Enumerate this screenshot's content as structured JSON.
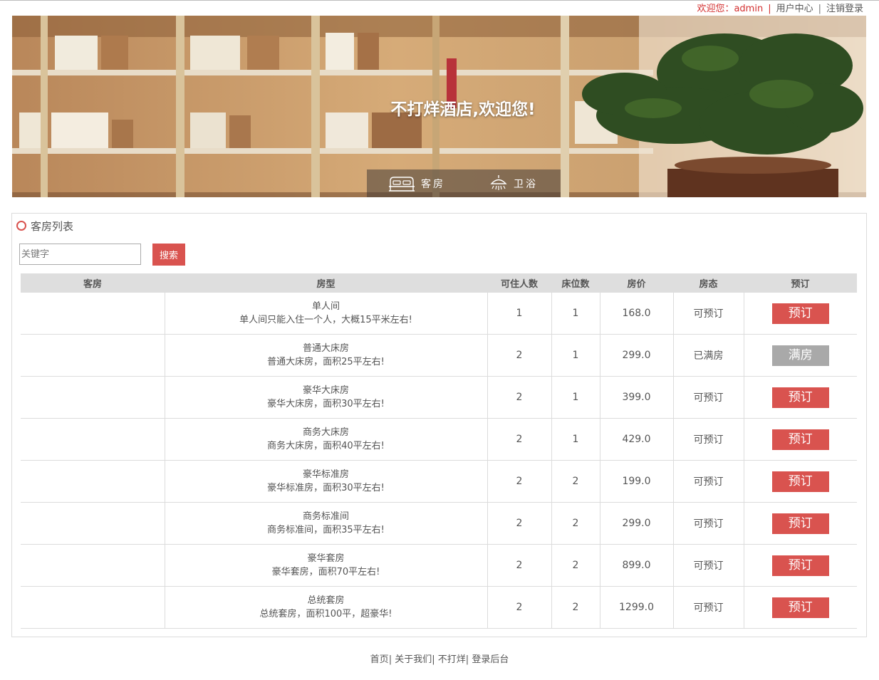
{
  "topbar": {
    "welcome": "欢迎您：admin",
    "sep": "|",
    "user_center": "用户中心",
    "logout": "注销登录"
  },
  "banner": {
    "title": "不打烊酒店,欢迎您!",
    "nav": [
      {
        "label": "客房",
        "icon": "bed-icon"
      },
      {
        "label": "卫浴",
        "icon": "shower-icon"
      }
    ]
  },
  "panel": {
    "title": "客房列表",
    "search_placeholder": "关键字",
    "search_button": "搜索"
  },
  "table": {
    "headers": [
      "客房",
      "房型",
      "可住人数",
      "床位数",
      "房价",
      "房态",
      "预订"
    ],
    "rows": [
      {
        "name": "单人间",
        "desc": "单人间只能入住一个人，大概15平米左右!",
        "people": "1",
        "beds": "1",
        "price": "168.0",
        "status": "可预订",
        "action": "预订",
        "available": true
      },
      {
        "name": "普通大床房",
        "desc": "普通大床房，面积25平左右!",
        "people": "2",
        "beds": "1",
        "price": "299.0",
        "status": "已满房",
        "action": "满房",
        "available": false
      },
      {
        "name": "豪华大床房",
        "desc": "豪华大床房，面积30平左右!",
        "people": "2",
        "beds": "1",
        "price": "399.0",
        "status": "可预订",
        "action": "预订",
        "available": true
      },
      {
        "name": "商务大床房",
        "desc": "商务大床房，面积40平左右!",
        "people": "2",
        "beds": "1",
        "price": "429.0",
        "status": "可预订",
        "action": "预订",
        "available": true
      },
      {
        "name": "豪华标准房",
        "desc": "豪华标准房，面积30平左右!",
        "people": "2",
        "beds": "2",
        "price": "199.0",
        "status": "可预订",
        "action": "预订",
        "available": true
      },
      {
        "name": "商务标准间",
        "desc": "商务标准间，面积35平左右!",
        "people": "2",
        "beds": "2",
        "price": "299.0",
        "status": "可预订",
        "action": "预订",
        "available": true
      },
      {
        "name": "豪华套房",
        "desc": "豪华套房，面积70平左右!",
        "people": "2",
        "beds": "2",
        "price": "899.0",
        "status": "可预订",
        "action": "预订",
        "available": true
      },
      {
        "name": "总统套房",
        "desc": "总统套房，面积100平，超豪华!",
        "people": "2",
        "beds": "2",
        "price": "1299.0",
        "status": "可预订",
        "action": "预订",
        "available": true
      }
    ]
  },
  "footer": {
    "links": [
      "首页",
      "关于我们",
      "不打烊",
      "登录后台"
    ],
    "sep": "|"
  },
  "colors": {
    "accent": "#d9534f",
    "full": "#a9a9a9",
    "welcome": "#d32f2f"
  }
}
